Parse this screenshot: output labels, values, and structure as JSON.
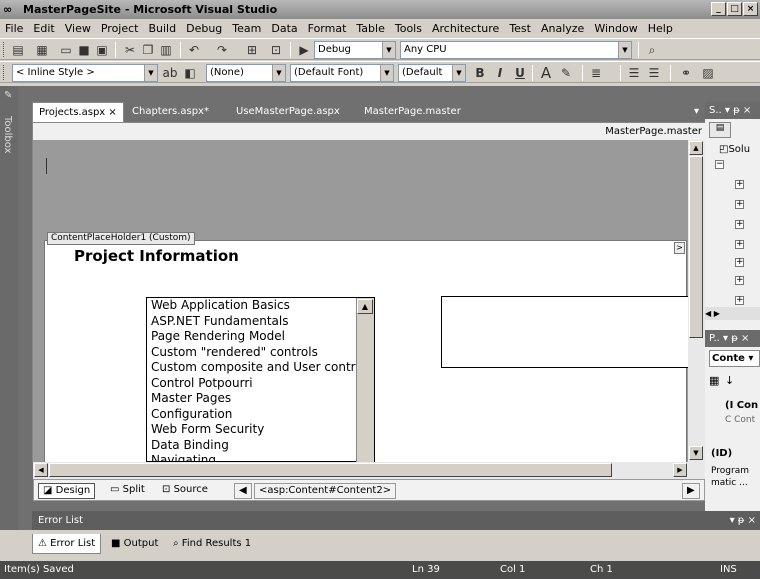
{
  "window": {
    "title": "MasterPageSite - Microsoft Visual Studio",
    "min": "_",
    "max": "□",
    "close": "×"
  },
  "menu": [
    "File",
    "Edit",
    "View",
    "Project",
    "Build",
    "Debug",
    "Team",
    "Data",
    "Format",
    "Table",
    "Tools",
    "Architecture",
    "Test",
    "Analyze",
    "Window",
    "Help"
  ],
  "toolbar1": {
    "config": "Debug",
    "platform": "Any CPU"
  },
  "toolbar2": {
    "style": "< Inline Style >",
    "block": "(None)",
    "font": "(Default Font)",
    "size": "(Default",
    "bold": "B",
    "italic": "I",
    "underline": "U"
  },
  "toolbox": {
    "label": "Toolbox"
  },
  "tabs": [
    {
      "label": "Projects.aspx",
      "close": "×"
    },
    {
      "label": "Chapters.aspx*"
    },
    {
      "label": "UseMasterPage.aspx"
    },
    {
      "label": "MasterPage.master"
    }
  ],
  "editor": {
    "master_label": "MasterPage.master",
    "placeholder_label": "ContentPlaceHolder1 (Custom)",
    "page_title": "Project Information",
    "list_items": [
      "Web Application Basics",
      "ASP.NET Fundamentals",
      "Page Rendering Model",
      "Custom \"rendered\" controls",
      "Custom composite and User controls",
      "Control Potpourri",
      "Master Pages",
      "Configuration",
      "Web Form Security",
      "Data Binding",
      "Navigating"
    ]
  },
  "viewbar": {
    "design": "Design",
    "split": "Split",
    "source": "Source",
    "crumb": "<asp:Content#Content2>"
  },
  "right_panel": {
    "solution_header": "S.. ▾ ᵽ ×",
    "solution_root": "Solu",
    "props_header": "P.. ▾ ᵽ ×",
    "props_combo": "Conte",
    "props_sel": "(I Con",
    "props_sel2": "C Cont",
    "id_label": "(ID)",
    "id_desc1": "Program",
    "id_desc2": "matic ..."
  },
  "error_panel": {
    "title": "Error List",
    "pin": "▾ ᵽ ×"
  },
  "bottom_tabs": [
    "Error List",
    "Output",
    "Find Results 1"
  ],
  "status": {
    "message": "Item(s) Saved",
    "ln": "Ln 39",
    "col": "Col 1",
    "ch": "Ch 1",
    "mode": "INS"
  }
}
